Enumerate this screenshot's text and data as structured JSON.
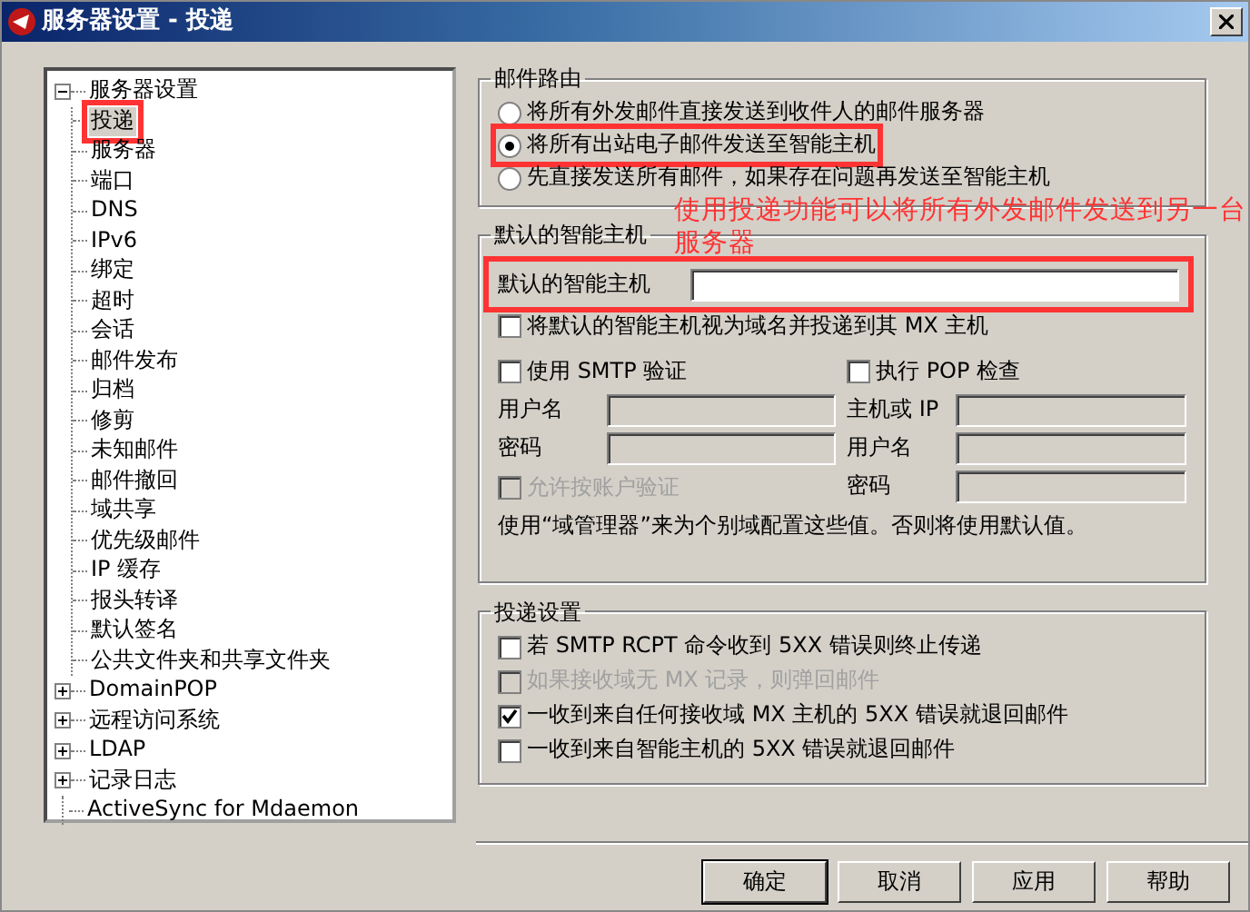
{
  "window": {
    "title": "服务器设置 - 投递"
  },
  "tree": [
    {
      "label": "服务器设置",
      "expanded": true,
      "children": [
        {
          "label": "投递",
          "selected": true,
          "highlighted": true
        },
        {
          "label": "服务器",
          "selected": false
        },
        {
          "label": "端口",
          "selected": false
        },
        {
          "label": "DNS",
          "selected": false
        },
        {
          "label": "IPv6",
          "selected": false
        },
        {
          "label": "绑定",
          "selected": false
        },
        {
          "label": "超时",
          "selected": false
        },
        {
          "label": "会话",
          "selected": false
        },
        {
          "label": "邮件发布",
          "selected": false
        },
        {
          "label": "归档",
          "selected": false
        },
        {
          "label": "修剪",
          "selected": false
        },
        {
          "label": "未知邮件",
          "selected": false
        },
        {
          "label": "邮件撤回",
          "selected": false
        },
        {
          "label": "域共享",
          "selected": false
        },
        {
          "label": "优先级邮件",
          "selected": false
        },
        {
          "label": "IP 缓存",
          "selected": false
        },
        {
          "label": "报头转译",
          "selected": false
        },
        {
          "label": "默认签名",
          "selected": false
        },
        {
          "label": "公共文件夹和共享文件夹",
          "selected": false
        }
      ]
    },
    {
      "label": "DomainPOP",
      "expanded": false
    },
    {
      "label": "远程访问系统",
      "expanded": false
    },
    {
      "label": "LDAP",
      "expanded": false
    },
    {
      "label": "记录日志",
      "expanded": false
    },
    {
      "label": "ActiveSync for Mdaemon"
    }
  ],
  "mail_routing": {
    "title": "邮件路由",
    "options": [
      {
        "label": "将所有外发邮件直接发送到收件人的邮件服务器",
        "selected": false,
        "highlighted": false
      },
      {
        "label": "将所有出站电子邮件发送至智能主机",
        "selected": true,
        "highlighted": true
      },
      {
        "label": "先直接发送所有邮件，如果存在问题再发送至智能主机",
        "selected": false,
        "highlighted": false
      }
    ]
  },
  "annotation": {
    "text": "使用投递功能可以将所有外发邮件发送到另一台服务器"
  },
  "smart_host": {
    "title": "默认的智能主机",
    "host_label": "默认的智能主机",
    "highlighted": true,
    "treat_as_domain": {
      "label": "将默认的智能主机视为域名并投递到其 MX 主机",
      "checked": false,
      "disabled": false
    },
    "smtp_auth": {
      "label": "使用 SMTP 验证",
      "checked": false,
      "disabled": false
    },
    "smtp_fields": [
      {
        "label": "用户名"
      },
      {
        "label": "密码"
      }
    ],
    "allow_account_auth": {
      "label": "允许按账户验证",
      "checked": false,
      "disabled": true
    },
    "pop_check": {
      "label": "执行 POP 检查",
      "checked": false,
      "disabled": false
    },
    "pop_fields": [
      {
        "label": "主机或 IP"
      },
      {
        "label": "用户名"
      },
      {
        "label": "密码"
      }
    ],
    "note": "使用“域管理器”来为个别域配置这些值。否则将使用默认值。"
  },
  "delivery_settings": {
    "title": "投递设置",
    "options": [
      {
        "label": "若 SMTP RCPT 命令收到 5XX 错误则终止传递",
        "checked": false,
        "disabled": false
      },
      {
        "label": "如果接收域无 MX 记录，则弹回邮件",
        "checked": false,
        "disabled": true
      },
      {
        "label": "一收到来自任何接收域 MX 主机的 5XX 错误就退回邮件",
        "checked": true,
        "disabled": false
      },
      {
        "label": "一收到来自智能主机的 5XX 错误就退回邮件",
        "checked": false,
        "disabled": false
      }
    ]
  },
  "buttons": [
    {
      "label": "确定",
      "default": true
    },
    {
      "label": "取消",
      "default": false
    },
    {
      "label": "应用",
      "default": false
    },
    {
      "label": "帮助",
      "default": false
    }
  ]
}
